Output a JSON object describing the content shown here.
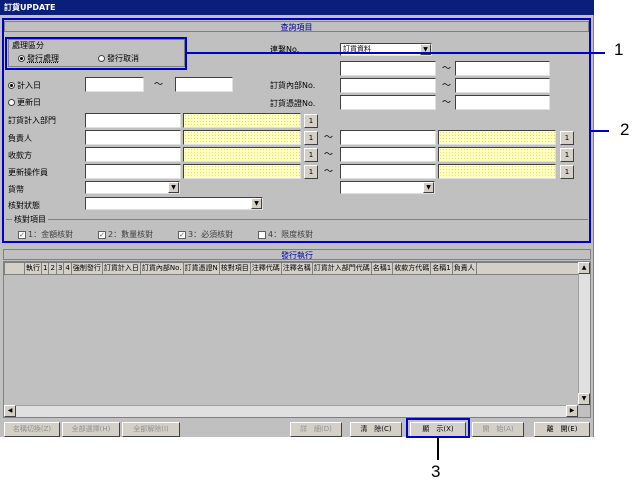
{
  "window": {
    "title": "訂貨UPDATE"
  },
  "search_section": {
    "header": "查詢項目",
    "processing_group": {
      "label": "處理區分",
      "options": [
        "發行處理",
        "發行取消"
      ],
      "selected": 0
    },
    "contact_no": {
      "label": "連繫No.",
      "value": "訂貨資料"
    },
    "order_internal_no": {
      "label": "訂貨內部No."
    },
    "order_voucher_no": {
      "label": "訂貨憑證No."
    },
    "date_options": [
      "計入日",
      "更新日"
    ],
    "date_selected": 0,
    "range_sep": "〜",
    "rows": [
      {
        "label": "訂貨計入部門",
        "btn": "1"
      },
      {
        "label": "負責人",
        "btn": "1"
      },
      {
        "label": "收款方",
        "btn": "1"
      },
      {
        "label": "更新操作員",
        "btn": "1"
      }
    ],
    "currency": {
      "label": "貨幣"
    },
    "check_status": {
      "label": "核對狀態"
    },
    "check_items": {
      "label": "核對項目",
      "items": [
        "1：金額核對",
        "2：數量核對",
        "3：必須核對",
        "4：限度核對"
      ],
      "checked": [
        true,
        true,
        true,
        false
      ]
    }
  },
  "issue_section": {
    "header": "發行執行",
    "columns": [
      "執行",
      "1",
      "2",
      "3",
      "4",
      "強制發行",
      "訂貨計入日",
      "訂貨內部No.",
      "訂貨憑證N",
      "核對項目",
      "注釋代碼",
      "注釋名稱",
      "訂貨計入部門代碼",
      "名稱1",
      "收款方代碼",
      "名稱1",
      "負責人"
    ]
  },
  "footer_buttons": [
    {
      "label": "名稱切換(Z)",
      "enabled": false
    },
    {
      "label": "全部選擇(H)",
      "enabled": false
    },
    {
      "label": "全部解除(I)",
      "enabled": false
    },
    {
      "label": "詳　細(D)",
      "enabled": false
    },
    {
      "label": "清　除(C)",
      "enabled": true
    },
    {
      "label": "顯　示(X)",
      "enabled": true
    },
    {
      "label": "開　始(A)",
      "enabled": false
    },
    {
      "label": "離　開(E)",
      "enabled": true
    }
  ],
  "callouts": [
    "1",
    "2",
    "3"
  ],
  "colors": {
    "title_bg": "#0a1f7a",
    "highlight": "#0000cc",
    "yellow_field": "#ffffc0"
  }
}
